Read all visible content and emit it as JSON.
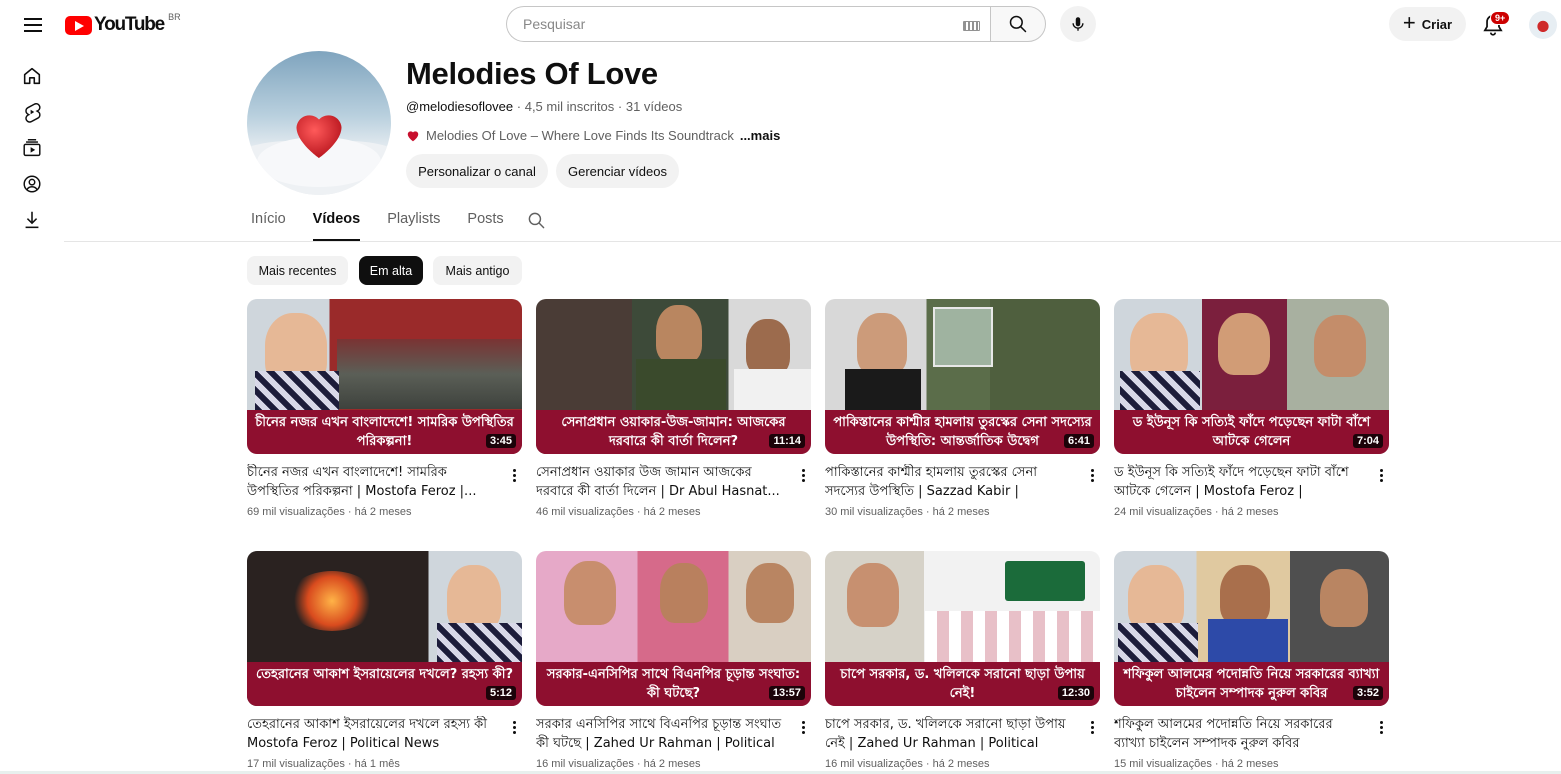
{
  "header": {
    "logo_text": "YouTube",
    "country_code": "BR",
    "search_placeholder": "Pesquisar",
    "create_label": "Criar",
    "notifications_badge": "9+"
  },
  "rail": {
    "items": [
      "home-icon",
      "shorts-icon",
      "subscriptions-icon",
      "you-icon",
      "downloads-icon"
    ]
  },
  "channel": {
    "name": "Melodies Of Love",
    "handle": "@melodiesoflovee",
    "stats": " · 4,5 mil inscritos · 31 vídeos",
    "description": "Melodies Of Love – Where Love Finds Its Soundtrack",
    "more_label": "...mais",
    "customize_label": "Personalizar o canal",
    "manage_label": "Gerenciar vídeos"
  },
  "tabs": [
    {
      "label": "Início",
      "active": false
    },
    {
      "label": "Vídeos",
      "active": true
    },
    {
      "label": "Playlists",
      "active": false
    },
    {
      "label": "Posts",
      "active": false
    }
  ],
  "chips": [
    {
      "label": "Mais recentes",
      "active": false
    },
    {
      "label": "Em alta",
      "active": true
    },
    {
      "label": "Mais antigo",
      "active": false
    }
  ],
  "videos": [
    {
      "caption": "চীনের নজর এখন বাংলাদেশে! সামরিক উপস্থিতির পরিকল্পনা!",
      "duration": "3:45",
      "title": "চীনের নজর এখন বাংলাদেশে! সামরিক উপস্থিতির পরিকল্পনা | Mostofa Feroz |...",
      "views": "69 mil visualizações",
      "age": "há 2 meses"
    },
    {
      "caption": "সেনাপ্রধান ওয়াকার-উজ-জামান: আজকের দরবারে কী বার্তা দিলেন?",
      "duration": "11:14",
      "title": "সেনাপ্রধান ওয়াকার উজ জামান আজকের দরবারে কী বার্তা দিলেন | Dr Abul Hasnat...",
      "views": "46 mil visualizações",
      "age": "há 2 meses"
    },
    {
      "caption": "পাকিস্তানের কাশ্মীর হামলায় তুরস্কের সেনা সদস্যের উপস্থিতি: আন্তর্জাতিক উদ্বেগ",
      "duration": "6:41",
      "title": "পাকিস্তানের কাশ্মীর হামলায় তুরস্কের সেনা সদস্যের উপস্থিতি | Sazzad Kabir | পলিটিক্যা...",
      "views": "30 mil visualizações",
      "age": "há 2 meses"
    },
    {
      "caption": "ড ইউনূস কি সত্যিই ফাঁদে পড়েছেন ফাটা বাঁশে আটকে গেলেন",
      "duration": "7:04",
      "title": "ড ইউনূস কি সত্যিই ফাঁদে পড়েছেন ফাটা বাঁশে আটকে গেলেন | Mostofa Feroz | পলিটিক্যাল...",
      "views": "24 mil visualizações",
      "age": "há 2 meses"
    },
    {
      "caption": "তেহরানের আকাশ ইসরায়েলের দখলে? রহস্য কী?",
      "duration": "5:12",
      "title": "তেহরানের আকাশ ইসরায়েলের দখলে রহস্য কী Mostofa Feroz | Political News",
      "views": "17 mil visualizações",
      "age": "há 1 mês"
    },
    {
      "caption": "সরকার-এনসিপির সাথে বিএনপির চূড়ান্ত সংঘাত: কী ঘটছে?",
      "duration": "13:57",
      "title": "সরকার এনসিপির সাথে বিএনপির চূড়ান্ত সংঘাত কী ঘটছে | Zahed Ur Rahman | Political News",
      "views": "16 mil visualizações",
      "age": "há 2 meses"
    },
    {
      "caption": "চাপে সরকার, ড. খলিলকে সরানো ছাড়া উপায় নেই!",
      "duration": "12:30",
      "title": "চাপে সরকার, ড. খলিলকে সরানো ছাড়া উপায় নেই | Zahed Ur Rahman | Political News",
      "views": "16 mil visualizações",
      "age": "há 2 meses"
    },
    {
      "caption": "শফিকুল আলমের পদোন্নতি নিয়ে সরকারের ব্যাখ্যা চাইলেন সম্পাদক নুরুল কবির",
      "duration": "3:52",
      "title": "শফিকুল আলমের পদোন্নতি নিয়ে সরকারের ব্যাখ্যা চাইলেন সম্পাদক নুরুল কবির Mostofa...",
      "views": "15 mil visualizações",
      "age": "há 2 meses"
    }
  ],
  "colors": {
    "brand_red": "#ff0000",
    "caption_bg": "#8e0f2f",
    "text_primary": "#0f0f0f",
    "text_secondary": "#606060"
  }
}
